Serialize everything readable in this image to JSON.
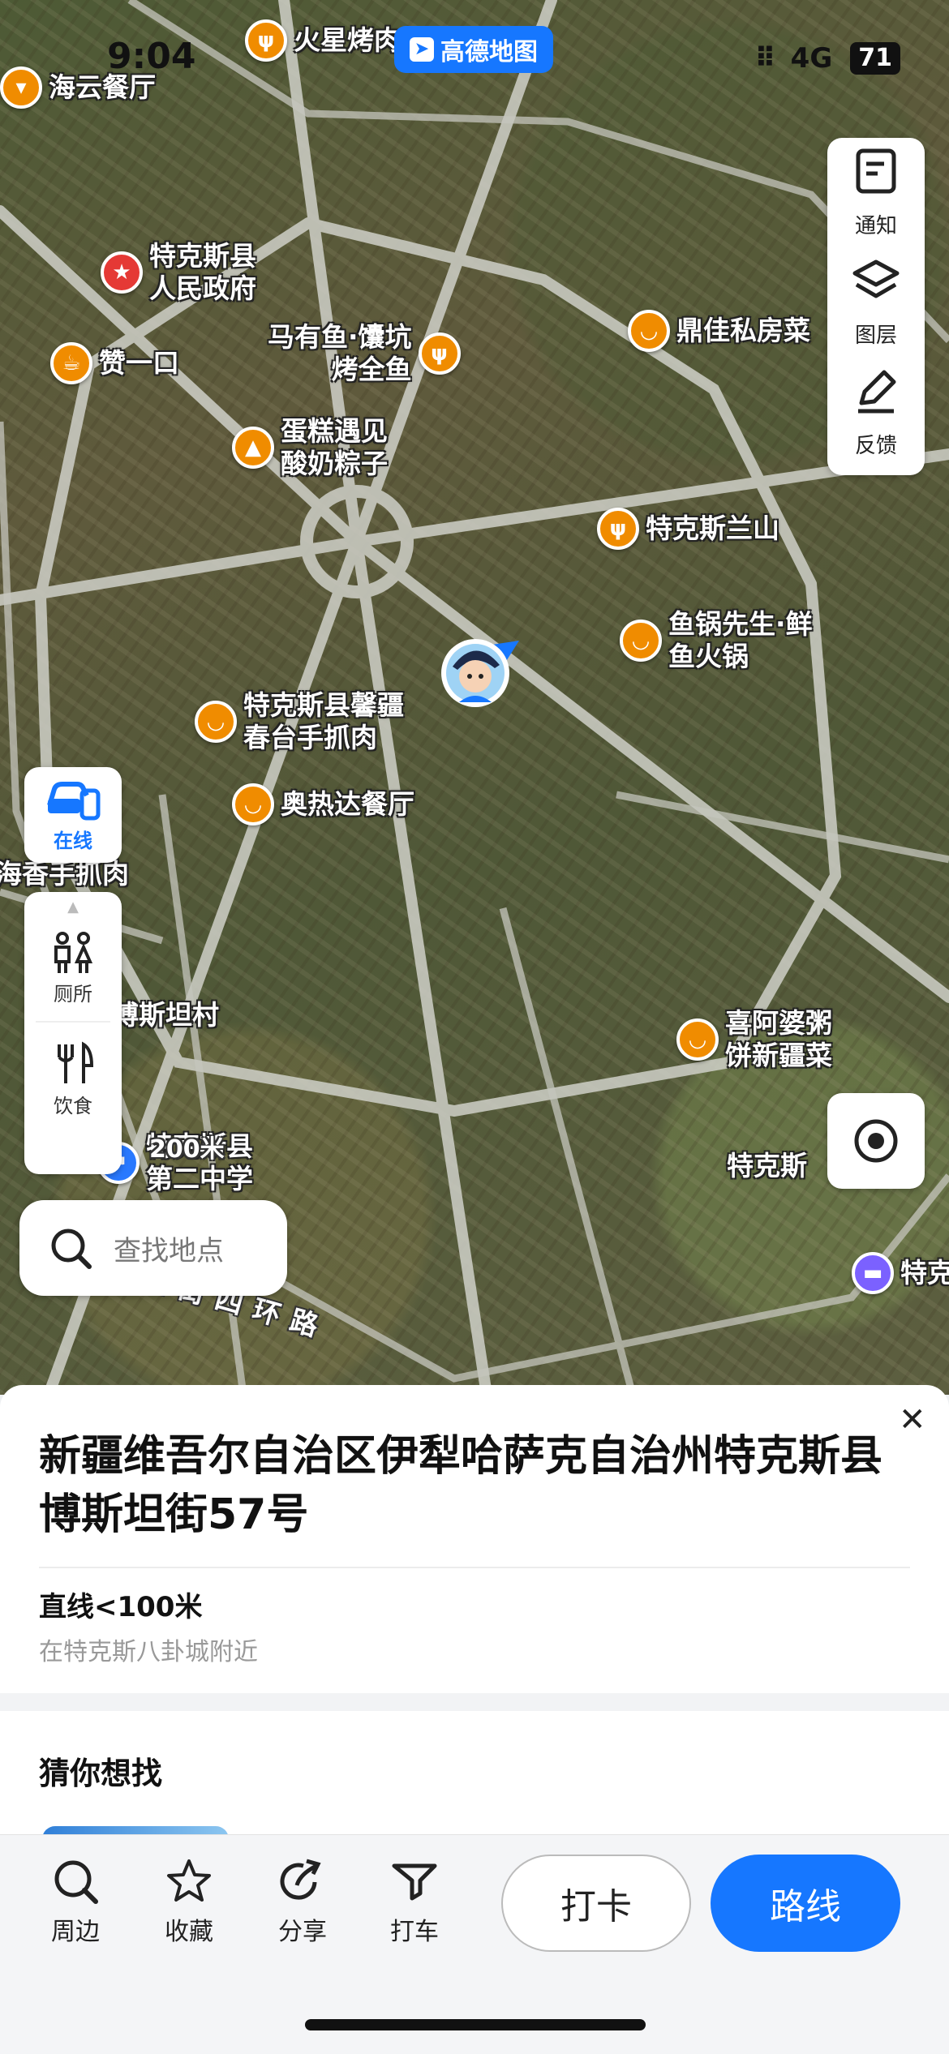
{
  "status": {
    "time": "9:04",
    "network": "4G",
    "battery": "71"
  },
  "brand": {
    "label": "高德地图"
  },
  "right_tools": [
    {
      "label": "通知",
      "icon": "notice-icon"
    },
    {
      "label": "图层",
      "icon": "layers-icon"
    },
    {
      "label": "反馈",
      "icon": "feedback-icon"
    }
  ],
  "left_tools": {
    "online": "在线",
    "toilet": "厕所",
    "food": "饮食"
  },
  "map": {
    "pois": {
      "haiyun": "海云餐厅",
      "huoxing": "火星烤肉",
      "gov": "特克斯县\n人民政府",
      "zanyikou": "赞一口",
      "mayouyu": "马有鱼·馕坑\n烤全鱼",
      "dingjia": "鼎佳私房菜",
      "dangao": "蛋糕遇见\n酸奶粽子",
      "lanshan": "特克斯兰山",
      "yuguo": "鱼锅先生·鲜\n鱼火锅",
      "xinjiang": "特克斯县馨疆\n春台手抓肉",
      "aoreda": "奥热达餐厅",
      "haixiang": "海香手抓肉",
      "bositan": "博斯坦村",
      "xiapo": "喜阿婆粥\n饼新疆菜",
      "tekes_e": "特克斯",
      "school": "特克斯县\n第二中学",
      "hotel": "特克"
    },
    "road": "提街四环路",
    "scale": "200米"
  },
  "search": {
    "placeholder": "查找地点"
  },
  "detail": {
    "address": "新疆维吾尔自治区伊犁哈萨克自治州特克斯县博斯坦街57号",
    "distance": "直线<100米",
    "nearby": "在特克斯八卦城附近",
    "guess_title": "猜你想找"
  },
  "bottom": {
    "nearby": "周边",
    "favorite": "收藏",
    "share": "分享",
    "taxi": "打车",
    "checkin": "打卡",
    "route": "路线"
  },
  "colors": {
    "accent": "#1677ff",
    "poi_food": "#f08c00",
    "poi_gov": "#e53935"
  }
}
